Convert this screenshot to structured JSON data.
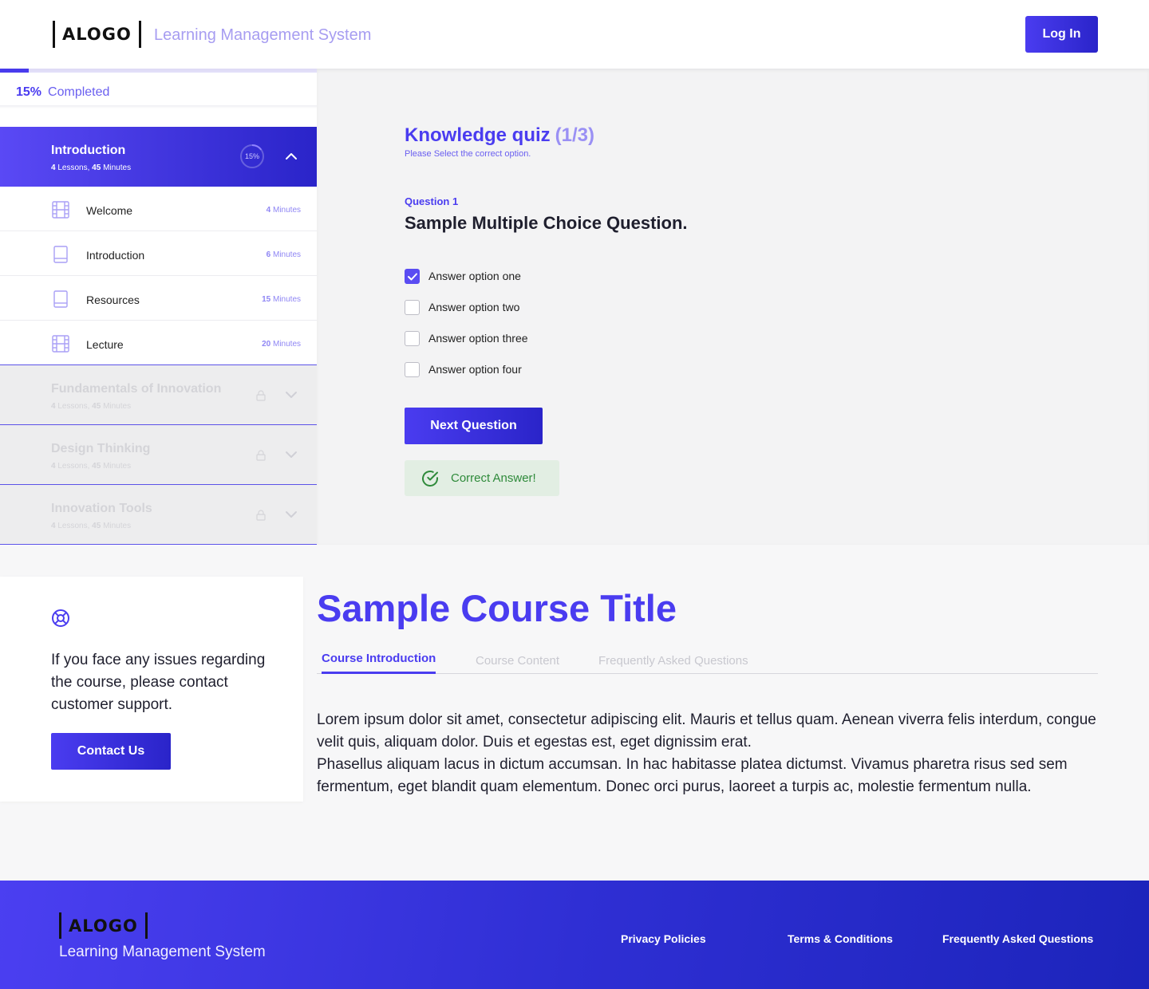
{
  "header": {
    "logo_text": "ALOGO",
    "subtitle": "Learning Management System",
    "login_label": "Log In"
  },
  "progress": {
    "percent_label": "15%",
    "completed_label": "Completed",
    "fraction": 0.15
  },
  "sidebar": {
    "active_module": {
      "title": "Introduction",
      "lessons_count": "4",
      "lessons_word": "Lessons,",
      "minutes_count": "45",
      "minutes_word": "Minutes",
      "progress_label": "15%"
    },
    "lessons": [
      {
        "name": "Welcome",
        "duration": "4",
        "unit": "Minutes",
        "icon": "film-icon"
      },
      {
        "name": "Introduction",
        "duration": "6",
        "unit": "Minutes",
        "icon": "book-icon"
      },
      {
        "name": "Resources",
        "duration": "15",
        "unit": "Minutes",
        "icon": "book-icon"
      },
      {
        "name": "Lecture",
        "duration": "20",
        "unit": "Minutes",
        "icon": "film-icon"
      }
    ],
    "locked_modules": [
      {
        "title": "Fundamentals of Innovation",
        "lessons_count": "4",
        "lessons_word": "Lessons,",
        "minutes_count": "45",
        "minutes_word": "Minutes"
      },
      {
        "title": "Design Thinking",
        "lessons_count": "4",
        "lessons_word": "Lessons,",
        "minutes_count": "45",
        "minutes_word": "Minutes"
      },
      {
        "title": "Innovation Tools",
        "lessons_count": "4",
        "lessons_word": "Lessons,",
        "minutes_count": "45",
        "minutes_word": "Minutes"
      }
    ]
  },
  "quiz": {
    "title": "Knowledge quiz",
    "counter": "(1/3)",
    "instruction": "Please Select the correct option.",
    "question_label": "Question 1",
    "question_text": "Sample Multiple Choice Question.",
    "options": [
      {
        "text": "Answer option one",
        "checked": true
      },
      {
        "text": "Answer option two",
        "checked": false
      },
      {
        "text": "Answer option three",
        "checked": false
      },
      {
        "text": "Answer option four",
        "checked": false
      }
    ],
    "next_label": "Next Question",
    "feedback": "Correct Answer!"
  },
  "support": {
    "text": "If you face any issues regarding the course, please contact customer support.",
    "button_label": "Contact Us"
  },
  "course": {
    "title": "Sample Course Title",
    "tabs": [
      "Course Introduction",
      "Course Content",
      "Frequently Asked Questions"
    ],
    "body_p1": "Lorem ipsum dolor sit amet, consectetur adipiscing elit. Mauris et tellus quam. Aenean viverra felis interdum, congue velit quis, aliquam dolor. Duis et egestas est, eget dignissim erat.",
    "body_p2": "Phasellus aliquam lacus in dictum accumsan. In hac habitasse platea dictumst. Vivamus pharetra risus sed sem fermentum, eget blandit quam elementum. Donec orci purus, laoreet a turpis ac, molestie fermentum nulla."
  },
  "footer": {
    "logo_text": "ALOGO",
    "subtitle": "Learning Management System",
    "links": [
      "Privacy Policies",
      "Terms & Conditions",
      "Frequently Asked Questions"
    ]
  },
  "colors": {
    "accent": "#4a3cf0",
    "accent_dark": "#2a24c9",
    "success": "#2e8a3a"
  }
}
